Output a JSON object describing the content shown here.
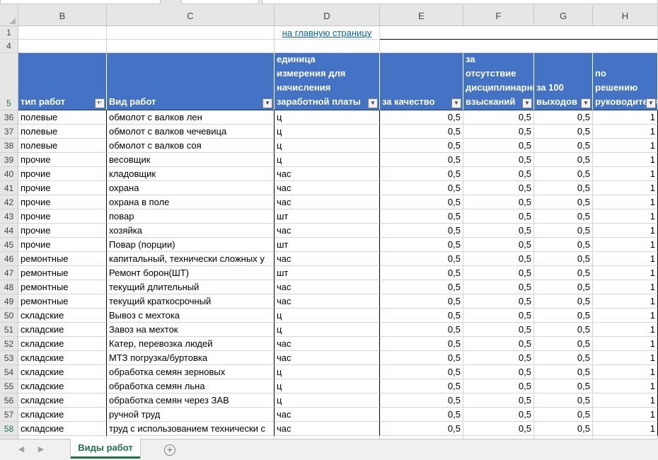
{
  "columns": [
    "B",
    "C",
    "D",
    "E",
    "F",
    "G",
    "H"
  ],
  "top_rows": [
    {
      "num": "1",
      "link": "на главную страницу"
    },
    {
      "num": "4"
    }
  ],
  "header_row": {
    "num": "5",
    "cells": [
      "тип  работ",
      "Вид работ",
      "единица измерения для начисления заработной платы",
      "за качество",
      "за отсутствие дисциплинарных взысканий",
      "за 100 выходов",
      "по решению руководителя"
    ],
    "filter_icons": [
      "sort-filter-icon",
      "filter-icon",
      "filter-icon",
      "filter-icon",
      "filter-icon",
      "filter-icon",
      "filter-icon"
    ]
  },
  "rows": [
    {
      "num": "36",
      "cells": [
        "полевые",
        "обмолот с валков лен",
        "ц",
        "0,5",
        "0,5",
        "0,5",
        "1"
      ]
    },
    {
      "num": "37",
      "cells": [
        "полевые",
        "обмолот с валков чечевица",
        "ц",
        "0,5",
        "0,5",
        "0,5",
        "1"
      ]
    },
    {
      "num": "38",
      "cells": [
        "полевые",
        "обмолот с валков соя",
        "ц",
        "0,5",
        "0,5",
        "0,5",
        "1"
      ]
    },
    {
      "num": "39",
      "cells": [
        "прочие",
        "весовщик",
        "ц",
        "0,5",
        "0,5",
        "0,5",
        "1"
      ]
    },
    {
      "num": "40",
      "cells": [
        "прочие",
        "кладовщик",
        "час",
        "0,5",
        "0,5",
        "0,5",
        "1"
      ]
    },
    {
      "num": "41",
      "cells": [
        "прочие",
        "охрана",
        "час",
        "0,5",
        "0,5",
        "0,5",
        "1"
      ]
    },
    {
      "num": "42",
      "cells": [
        "прочие",
        "охрана в поле",
        "час",
        "0,5",
        "0,5",
        "0,5",
        "1"
      ]
    },
    {
      "num": "43",
      "cells": [
        "прочие",
        "повар",
        "шт",
        "0,5",
        "0,5",
        "0,5",
        "1"
      ]
    },
    {
      "num": "44",
      "cells": [
        "прочие",
        "хозяйка",
        "час",
        "0,5",
        "0,5",
        "0,5",
        "1"
      ]
    },
    {
      "num": "45",
      "cells": [
        "прочие",
        "Повар (порции)",
        "шт",
        "0,5",
        "0,5",
        "0,5",
        "1"
      ]
    },
    {
      "num": "46",
      "cells": [
        "ремонтные",
        "капитальный, технически сложных у",
        "час",
        "0,5",
        "0,5",
        "0,5",
        "1"
      ]
    },
    {
      "num": "47",
      "cells": [
        "ремонтные",
        "Ремонт борон(ШТ)",
        "шт",
        "0,5",
        "0,5",
        "0,5",
        "1"
      ]
    },
    {
      "num": "48",
      "cells": [
        "ремонтные",
        "текущий длительный",
        "час",
        "0,5",
        "0,5",
        "0,5",
        "1"
      ]
    },
    {
      "num": "49",
      "cells": [
        "ремонтные",
        "текущий краткосрочный",
        "час",
        "0,5",
        "0,5",
        "0,5",
        "1"
      ]
    },
    {
      "num": "50",
      "cells": [
        "складские",
        "Вывоз с мехтока",
        "ц",
        "0,5",
        "0,5",
        "0,5",
        "1"
      ]
    },
    {
      "num": "51",
      "cells": [
        "складские",
        "Завоз на мехток",
        "ц",
        "0,5",
        "0,5",
        "0,5",
        "1"
      ]
    },
    {
      "num": "52",
      "cells": [
        "складские",
        "Катер, перевозка людей",
        "час",
        "0,5",
        "0,5",
        "0,5",
        "1"
      ]
    },
    {
      "num": "53",
      "cells": [
        "складские",
        "МТЗ погрузка/буртовка",
        "час",
        "0,5",
        "0,5",
        "0,5",
        "1"
      ]
    },
    {
      "num": "54",
      "cells": [
        "складские",
        "обработка семян зерновых",
        "ц",
        "0,5",
        "0,5",
        "0,5",
        "1"
      ]
    },
    {
      "num": "55",
      "cells": [
        "складские",
        "обработка семян льна",
        "ц",
        "0,5",
        "0,5",
        "0,5",
        "1"
      ]
    },
    {
      "num": "56",
      "cells": [
        "складские",
        "обработка семян через ЗАВ",
        "ц",
        "0,5",
        "0,5",
        "0,5",
        "1"
      ]
    },
    {
      "num": "57",
      "cells": [
        "складские",
        "ручной труд",
        "час",
        "0,5",
        "0,5",
        "0,5",
        "1"
      ]
    },
    {
      "num": "58",
      "cells": [
        "складские",
        "труд с использованием технически с",
        "час",
        "0,5",
        "0,5",
        "0,5",
        "1"
      ],
      "selected": true
    }
  ],
  "sheet_tabs": [
    {
      "label": "Виды работ",
      "active": true
    }
  ],
  "icons": {
    "prev_sheet": "chevron-left-icon",
    "next_sheet": "chevron-right-icon",
    "add_sheet": "plus-circle-icon"
  },
  "colors": {
    "header_fill": "#4472c4",
    "header_text": "#ffffff",
    "link": "#0563c1",
    "active_tab": "#217346"
  }
}
